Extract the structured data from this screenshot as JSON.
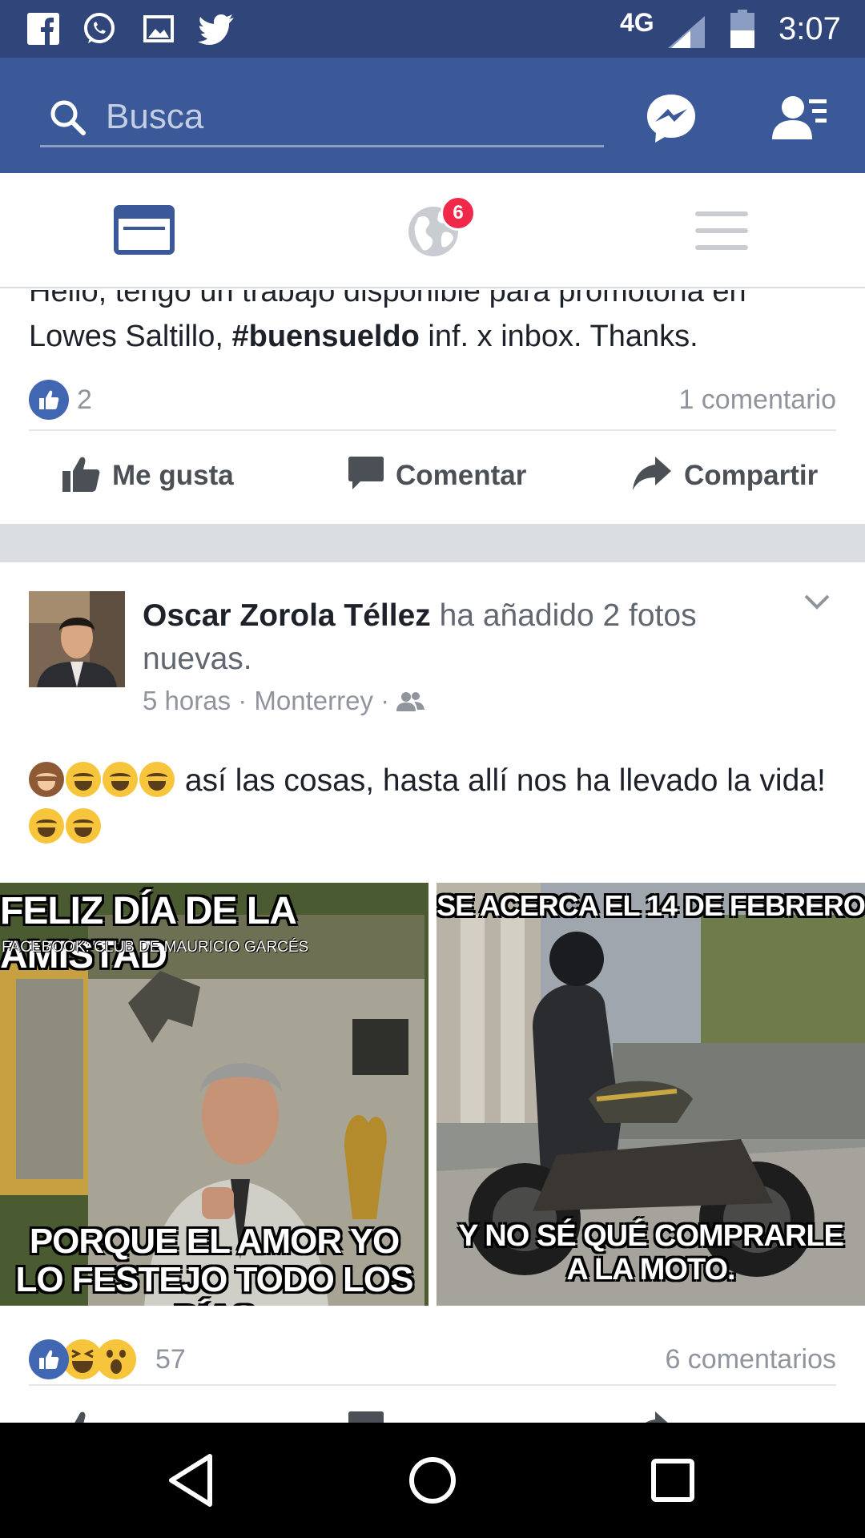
{
  "status_bar": {
    "network": "4G",
    "time": "3:07",
    "notification_icons": [
      "facebook-icon",
      "whatsapp-icon",
      "gallery-icon",
      "twitter-icon"
    ],
    "background_color": "#30457a"
  },
  "app_bar": {
    "search_placeholder": "Busca",
    "background_color": "#3b5998",
    "icons": [
      "search-icon",
      "messenger-icon",
      "friend-requests-icon"
    ]
  },
  "tabs": {
    "items": [
      {
        "name": "news-feed",
        "icon": "news-feed-icon",
        "active": true
      },
      {
        "name": "notifications",
        "icon": "globe-icon",
        "badge": "6"
      },
      {
        "name": "menu",
        "icon": "menu-icon"
      }
    ],
    "active_color": "#3b5998",
    "badge_color": "#f02849"
  },
  "post1": {
    "text_before": "Hello, tengo un trabajo disponible para promotoria en Lowes Saltillo, ",
    "hashtag": "#buensueldo",
    "text_after": " inf. x inbox. Thanks.",
    "reaction_count": "2",
    "comments": "1 comentario",
    "actions": {
      "like": "Me gusta",
      "comment": "Comentar",
      "share": "Compartir"
    }
  },
  "post2": {
    "author": "Oscar Zorola Téllez",
    "activity": " ha añadido 2 fotos nuevas.",
    "time": "5 horas",
    "location": "Monterrey",
    "audience_icon": "friends-icon",
    "text_main": " así las cosas, hasta allí nos ha llevado la vida!",
    "photos": [
      {
        "top": "FELIZ DÍA DE LA AMISTAD",
        "credit": "FACEBOOK: CLUB DE MAURICIO GARCÉS",
        "bottom_1": "PORQUE EL AMOR YO",
        "bottom_2": "LO FESTEJO TODO LOS DÍAS"
      },
      {
        "top": "SE ACERCA EL 14 DE FEBRERO",
        "bottom_1": "Y NO SÉ QUÉ COMPRARLE",
        "bottom_2": "A LA MOTO."
      }
    ],
    "reaction_count": "57",
    "comments": "6 comentarios",
    "reactions": [
      "like-icon",
      "haha-icon",
      "wow-icon"
    ]
  },
  "nav_bar": {
    "buttons": [
      "back-icon",
      "home-icon",
      "recents-icon"
    ]
  }
}
